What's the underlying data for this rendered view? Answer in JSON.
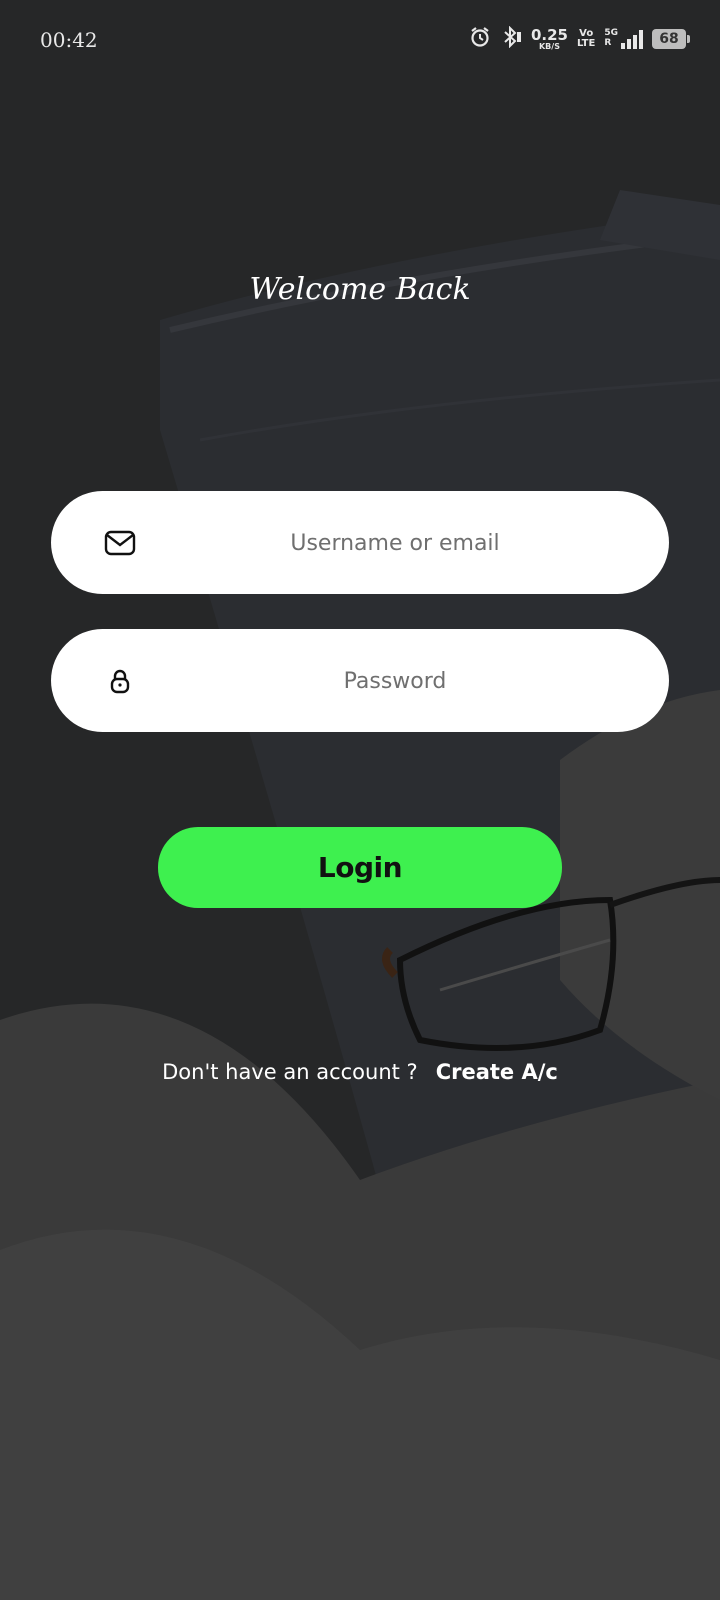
{
  "status_bar": {
    "time": "00:42",
    "net_speed_value": "0.25",
    "net_speed_unit": "KB/S",
    "volte_top": "Vo",
    "volte_bottom": "LTE",
    "network_type": "5G",
    "roaming": "R",
    "battery_level": "68",
    "icons": [
      "alarm-icon",
      "bluetooth-icon",
      "signal-icon",
      "battery-icon"
    ]
  },
  "login": {
    "title": "Welcome Back",
    "username_placeholder": "Username or email",
    "password_placeholder": "Password",
    "login_label": "Login",
    "no_account_prompt": "Don't have an account ?",
    "create_account_label": "Create A/c"
  },
  "colors": {
    "accent": "#3ef04f",
    "background": "#252627",
    "field": "#ffffff"
  }
}
